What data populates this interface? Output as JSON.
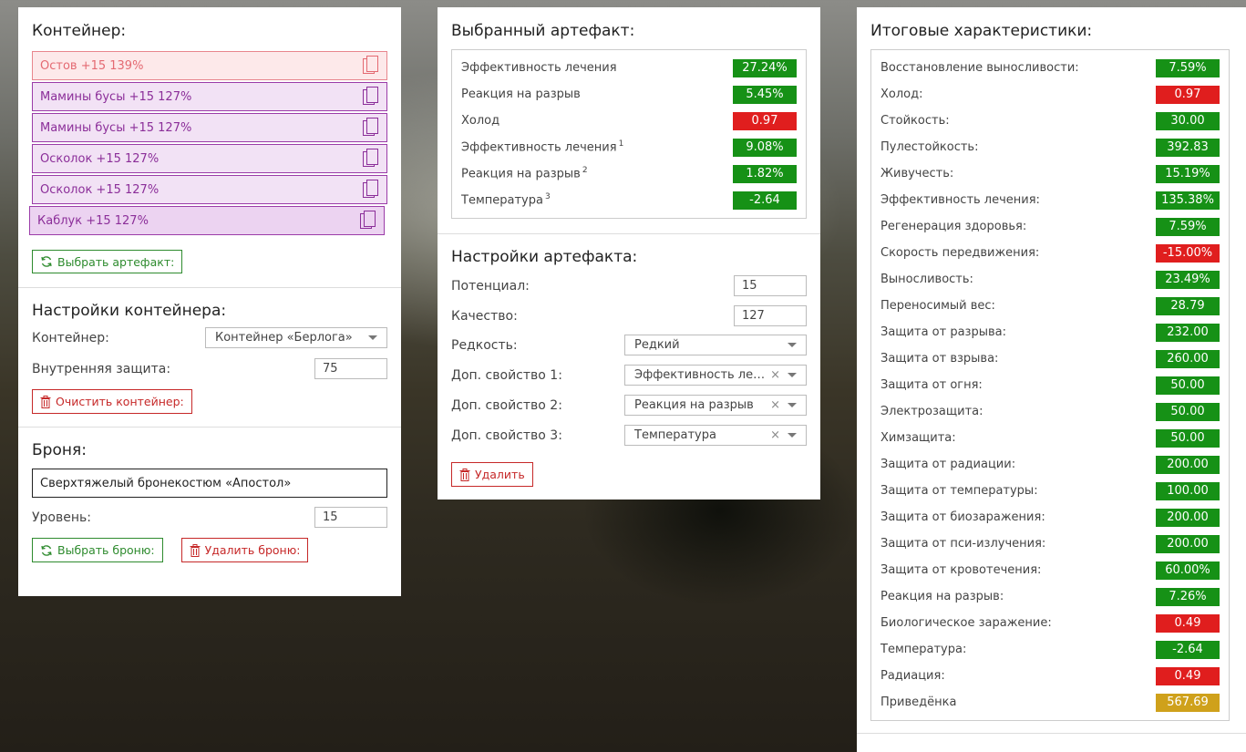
{
  "container": {
    "title": "Контейнер:",
    "items": [
      {
        "label": "Остов +15 139%",
        "style": "red"
      },
      {
        "label": "Мамины бусы +15 127%",
        "style": "purple"
      },
      {
        "label": "Мамины бусы +15 127%",
        "style": "purple"
      },
      {
        "label": "Осколок +15 127%",
        "style": "purple"
      },
      {
        "label": "Осколок +15 127%",
        "style": "purple"
      },
      {
        "label": "Каблук +15 127%",
        "style": "purple-dark"
      }
    ],
    "select_artifact_label": "Выбрать артефакт:"
  },
  "container_settings": {
    "title": "Настройки контейнера:",
    "container_label": "Контейнер:",
    "container_value": "Контейнер «Берлога»",
    "inner_protection_label": "Внутренняя защита:",
    "inner_protection_value": "75",
    "clear_label": "Очистить контейнер:"
  },
  "armor": {
    "title": "Броня:",
    "name": "Сверхтяжелый бронекостюм «Апостол»",
    "level_label": "Уровень:",
    "level_value": "15",
    "select_label": "Выбрать броню:",
    "delete_label": "Удалить броню:"
  },
  "selected_artifact": {
    "title": "Выбранный артефакт:",
    "stats": [
      {
        "label": "Эффективность лечения",
        "sup": "",
        "value": "27.24%",
        "color": "green"
      },
      {
        "label": "Реакция на разрыв",
        "sup": "",
        "value": "5.45%",
        "color": "green"
      },
      {
        "label": "Холод",
        "sup": "",
        "value": "0.97",
        "color": "red"
      },
      {
        "label": "Эффективность лечения",
        "sup": "1",
        "value": "9.08%",
        "color": "green"
      },
      {
        "label": "Реакция на разрыв",
        "sup": "2",
        "value": "1.82%",
        "color": "green"
      },
      {
        "label": "Температура",
        "sup": "3",
        "value": "-2.64",
        "color": "green"
      }
    ]
  },
  "artifact_settings": {
    "title": "Настройки артефакта:",
    "potential_label": "Потенциал:",
    "potential_value": "15",
    "quality_label": "Качество:",
    "quality_value": "127",
    "rarity_label": "Редкость:",
    "rarity_value": "Редкий",
    "prop1_label": "Доп. свойство 1:",
    "prop1_value": "Эффективность лечения",
    "prop2_label": "Доп. свойство 2:",
    "prop2_value": "Реакция на разрыв",
    "prop3_label": "Доп. свойство 3:",
    "prop3_value": "Температура",
    "delete_label": "Удалить"
  },
  "totals": {
    "title": "Итоговые характеристики:",
    "stats": [
      {
        "label": "Восстановление выносливости:",
        "value": "7.59%",
        "color": "green"
      },
      {
        "label": "Холод:",
        "value": "0.97",
        "color": "red"
      },
      {
        "label": "Стойкость:",
        "value": "30.00",
        "color": "green"
      },
      {
        "label": "Пулестойкость:",
        "value": "392.83",
        "color": "green"
      },
      {
        "label": "Живучесть:",
        "value": "15.19%",
        "color": "green"
      },
      {
        "label": "Эффективность лечения:",
        "value": "135.38%",
        "color": "green"
      },
      {
        "label": "Регенерация здоровья:",
        "value": "7.59%",
        "color": "green"
      },
      {
        "label": "Скорость передвижения:",
        "value": "-15.00%",
        "color": "red"
      },
      {
        "label": "Выносливость:",
        "value": "23.49%",
        "color": "green"
      },
      {
        "label": "Переносимый вес:",
        "value": "28.79",
        "color": "green"
      },
      {
        "label": "Защита от разрыва:",
        "value": "232.00",
        "color": "green"
      },
      {
        "label": "Защита от взрыва:",
        "value": "260.00",
        "color": "green"
      },
      {
        "label": "Защита от огня:",
        "value": "50.00",
        "color": "green"
      },
      {
        "label": "Электрозащита:",
        "value": "50.00",
        "color": "green"
      },
      {
        "label": "Химзащита:",
        "value": "50.00",
        "color": "green"
      },
      {
        "label": "Защита от радиации:",
        "value": "200.00",
        "color": "green"
      },
      {
        "label": "Защита от температуры:",
        "value": "100.00",
        "color": "green"
      },
      {
        "label": "Защита от биозаражения:",
        "value": "200.00",
        "color": "green"
      },
      {
        "label": "Защита от пси-излучения:",
        "value": "200.00",
        "color": "green"
      },
      {
        "label": "Защита от кровотечения:",
        "value": "60.00%",
        "color": "green"
      },
      {
        "label": "Реакция на разрыв:",
        "value": "7.26%",
        "color": "green"
      },
      {
        "label": "Биологическое заражение:",
        "value": "0.49",
        "color": "red"
      },
      {
        "label": "Температура:",
        "value": "-2.64",
        "color": "green"
      },
      {
        "label": "Радиация:",
        "value": "0.49",
        "color": "red"
      },
      {
        "label": "Приведёнка",
        "value": "567.69",
        "color": "yellow"
      }
    ]
  },
  "icons": [
    "copy-icon",
    "refresh-icon",
    "trash-icon",
    "chevron-down-icon",
    "clear-icon"
  ],
  "colors": {
    "green": "#169116",
    "red": "#e01e1e",
    "yellow": "#cfa11b",
    "purple": "#8b2e99",
    "pink": "#e46a72"
  }
}
